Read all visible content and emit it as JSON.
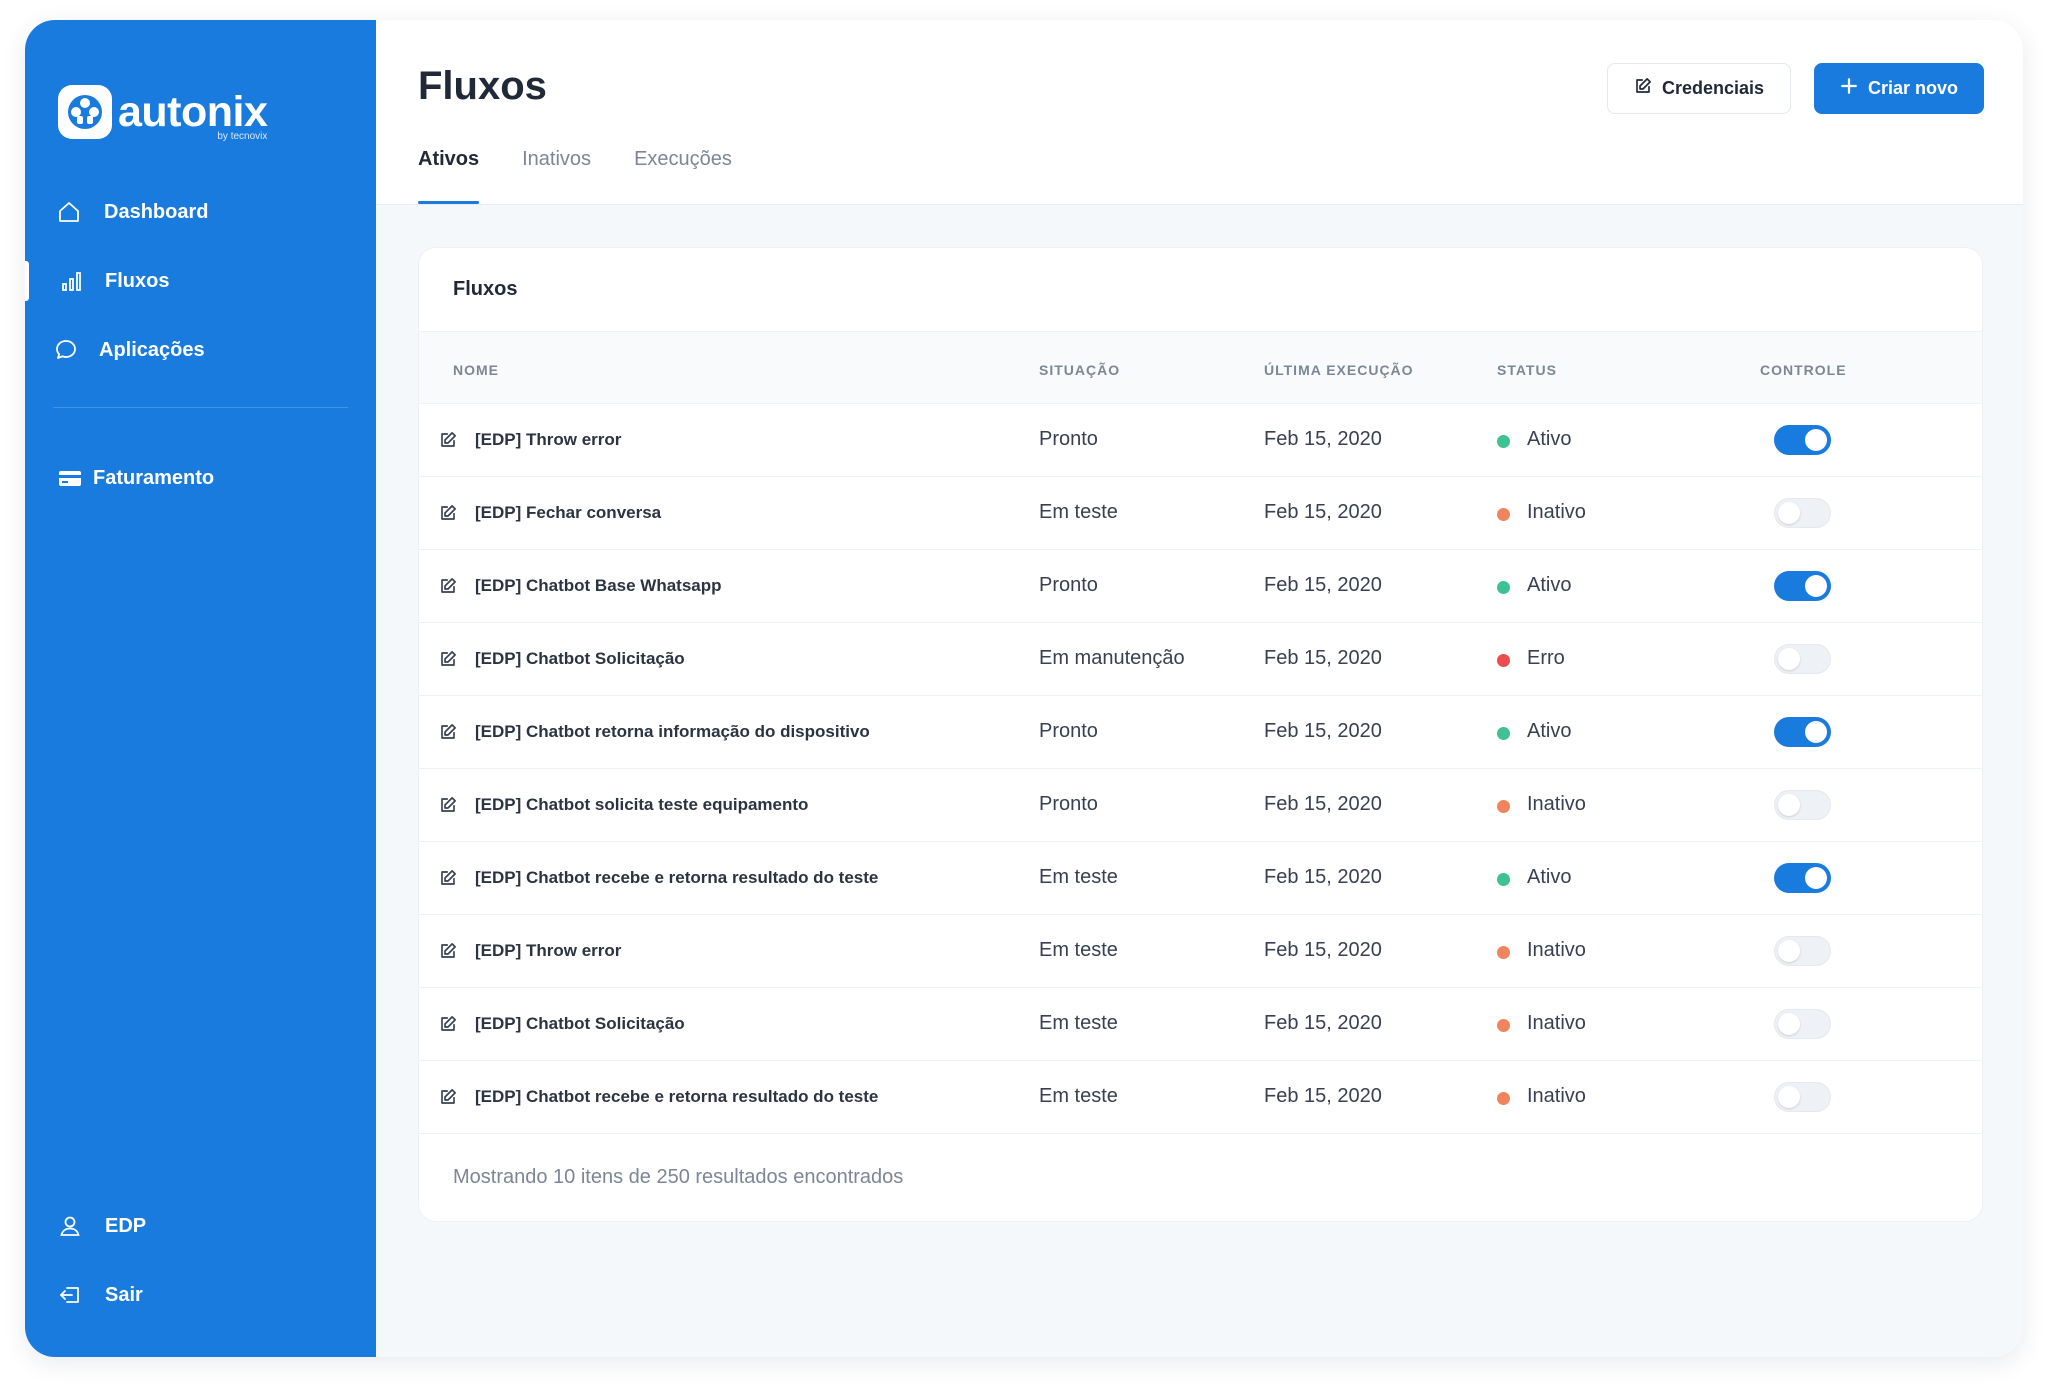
{
  "brand": {
    "name": "autonix",
    "tagline": "by tecnovix"
  },
  "sidebar": {
    "items": [
      {
        "label": "Dashboard",
        "icon": "home-icon"
      },
      {
        "label": "Fluxos",
        "icon": "bar-chart-icon",
        "active": true
      },
      {
        "label": "Aplicações",
        "icon": "chat-bubble-icon"
      },
      {
        "label": "Faturamento",
        "icon": "credit-card-icon"
      }
    ],
    "user": {
      "label": "EDP",
      "icon": "user-icon"
    },
    "logout": {
      "label": "Sair",
      "icon": "logout-icon"
    }
  },
  "header": {
    "title": "Fluxos",
    "credentials_label": "Credenciais",
    "create_label": "Criar novo"
  },
  "tabs": [
    "Ativos",
    "Inativos",
    "Execuções"
  ],
  "active_tab": "Ativos",
  "table": {
    "title": "Fluxos",
    "columns": [
      "NOME",
      "SITUAÇÃO",
      "ÚLTIMA EXECUÇÃO",
      "STATUS",
      "CONTROLE"
    ],
    "rows": [
      {
        "name": "[EDP] Throw error",
        "situation": "Pronto",
        "last_run": "Feb 15, 2020",
        "status": "Ativo",
        "enabled": true
      },
      {
        "name": "[EDP] Fechar conversa",
        "situation": "Em teste",
        "last_run": "Feb 15, 2020",
        "status": "Inativo",
        "enabled": false
      },
      {
        "name": "[EDP] Chatbot Base Whatsapp",
        "situation": "Pronto",
        "last_run": "Feb 15, 2020",
        "status": "Ativo",
        "enabled": true
      },
      {
        "name": "[EDP] Chatbot Solicitação",
        "situation": "Em manutenção",
        "last_run": "Feb 15, 2020",
        "status": "Erro",
        "enabled": false
      },
      {
        "name": "[EDP] Chatbot retorna informação do dispositivo",
        "situation": "Pronto",
        "last_run": "Feb 15, 2020",
        "status": "Ativo",
        "enabled": true
      },
      {
        "name": "[EDP] Chatbot solicita teste equipamento",
        "situation": "Pronto",
        "last_run": "Feb 15, 2020",
        "status": "Inativo",
        "enabled": false
      },
      {
        "name": "[EDP] Chatbot recebe e retorna resultado do teste",
        "situation": "Em teste",
        "last_run": "Feb 15, 2020",
        "status": "Ativo",
        "enabled": true
      },
      {
        "name": "[EDP] Throw error",
        "situation": "Em teste",
        "last_run": "Feb 15, 2020",
        "status": "Inativo",
        "enabled": false
      },
      {
        "name": "[EDP] Chatbot Solicitação",
        "situation": "Em teste",
        "last_run": "Feb 15, 2020",
        "status": "Inativo",
        "enabled": false
      },
      {
        "name": "[EDP] Chatbot recebe e retorna resultado do teste",
        "situation": "Em teste",
        "last_run": "Feb 15, 2020",
        "status": "Inativo",
        "enabled": false
      }
    ],
    "footer": "Mostrando 10 itens de 250 resultados encontrados"
  },
  "colors": {
    "primary": "#1a7bde",
    "status_ativo": "#3ec28f",
    "status_inativo": "#f0845c",
    "status_erro": "#ec4c4c"
  }
}
